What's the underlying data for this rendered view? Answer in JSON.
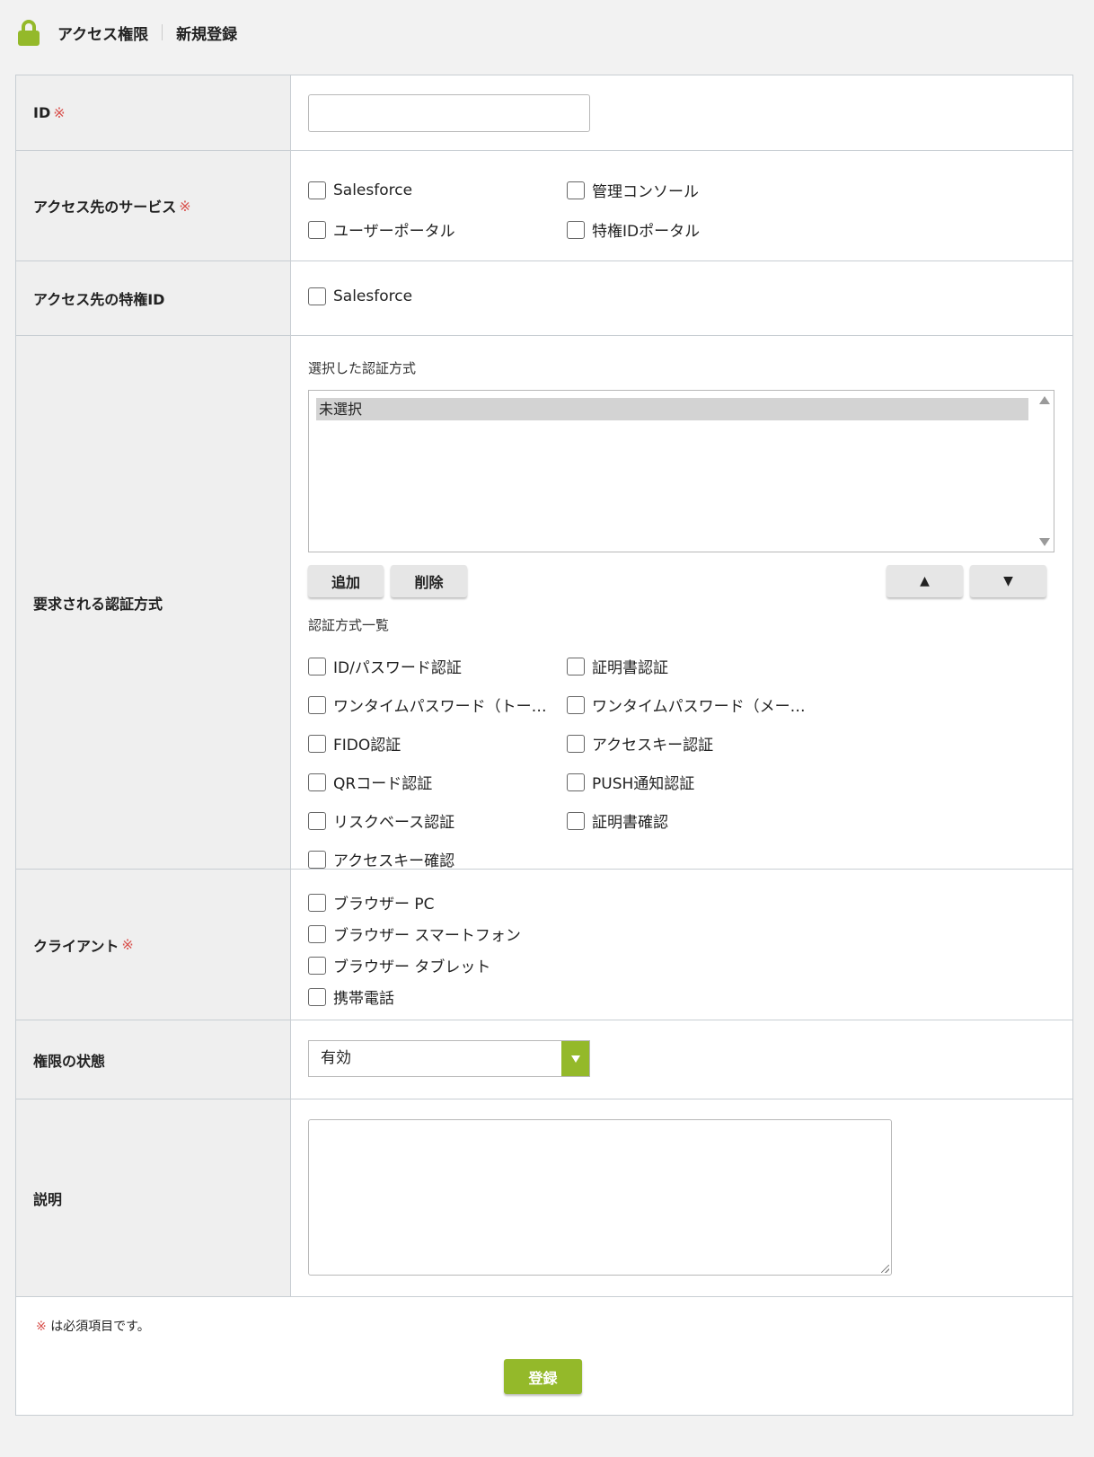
{
  "header": {
    "icon": "lock-icon",
    "accent_color": "#94b92a",
    "breadcrumb": [
      "アクセス権限",
      "新規登録"
    ]
  },
  "required_mark": "※",
  "fields": {
    "id": {
      "label": "ID",
      "value": ""
    },
    "services": {
      "label": "アクセス先のサービス",
      "options": [
        "Salesforce",
        "管理コンソール",
        "ユーザーポータル",
        "特権IDポータル"
      ]
    },
    "privileged_id": {
      "label": "アクセス先の特権ID",
      "options": [
        "Salesforce"
      ]
    },
    "auth": {
      "label": "要求される認証方式",
      "selected_title": "選択した認証方式",
      "selected_items": [
        "未選択"
      ],
      "add_button": "追加",
      "delete_button": "削除",
      "up_button": "▲",
      "down_button": "▼",
      "list_title": "認証方式一覧",
      "options": [
        "ID/パスワード認証",
        "証明書認証",
        "ワンタイムパスワード（トー…",
        "ワンタイムパスワード（メー…",
        "FIDO認証",
        "アクセスキー認証",
        "QRコード認証",
        "PUSH通知認証",
        "リスクベース認証",
        "証明書確認",
        "アクセスキー確認"
      ]
    },
    "client": {
      "label": "クライアント",
      "options": [
        "ブラウザー PC",
        "ブラウザー スマートフォン",
        "ブラウザー タブレット",
        "携帯電話"
      ]
    },
    "status": {
      "label": "権限の状態",
      "value": "有効"
    },
    "description": {
      "label": "説明",
      "value": ""
    }
  },
  "footer": {
    "note": "は必須項目です。",
    "submit": "登録"
  }
}
